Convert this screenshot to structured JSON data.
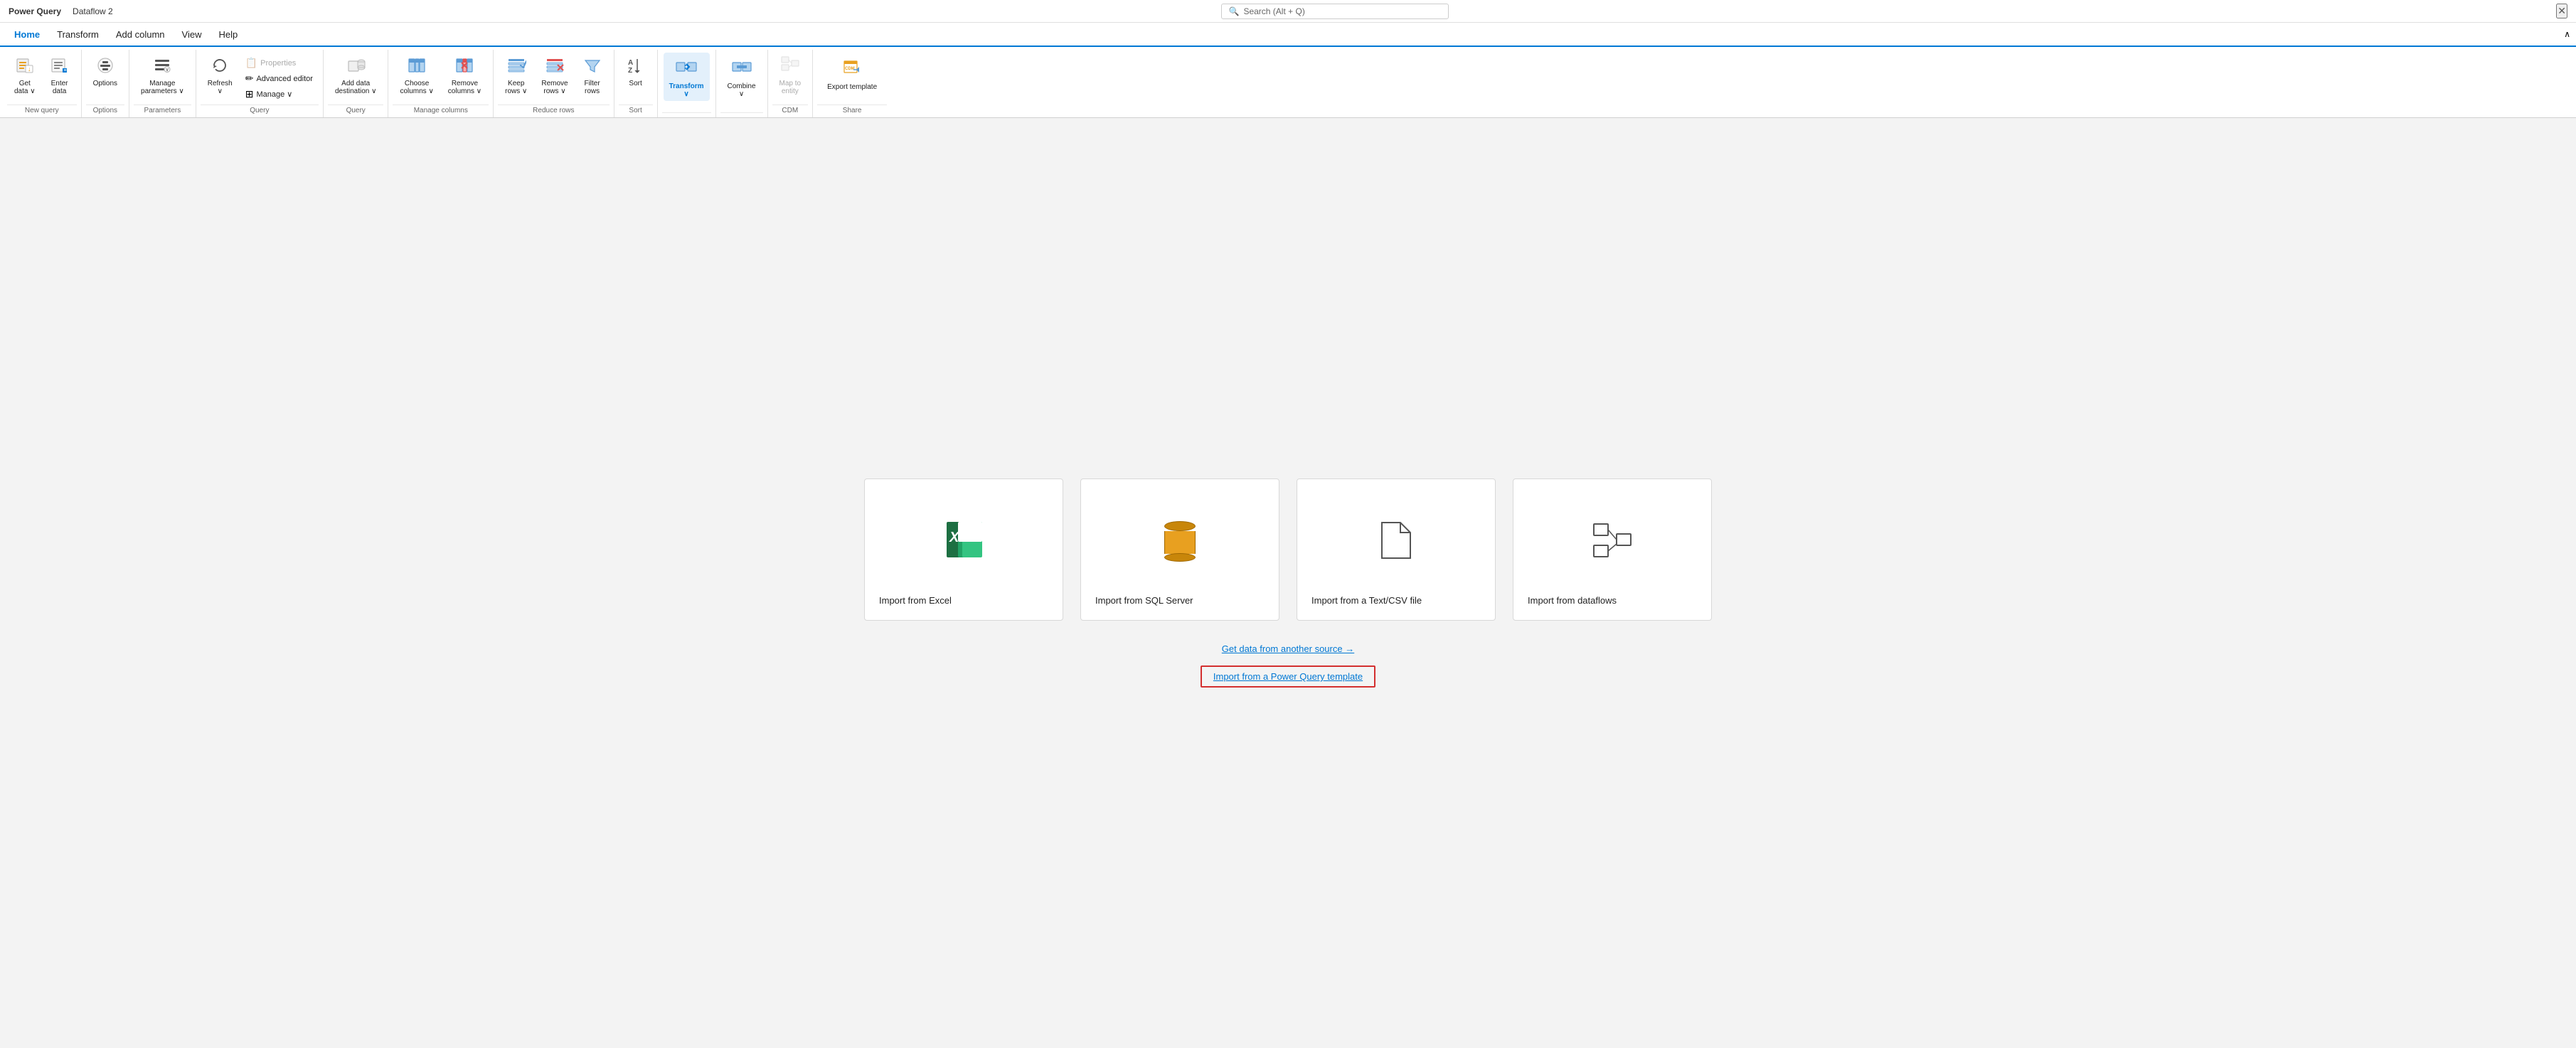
{
  "titleBar": {
    "appName": "Power Query",
    "docName": "Dataflow 2",
    "searchPlaceholder": "Search (Alt + Q)",
    "closeLabel": "✕"
  },
  "menuBar": {
    "items": [
      {
        "label": "Home",
        "active": true
      },
      {
        "label": "Transform",
        "active": false
      },
      {
        "label": "Add column",
        "active": false
      },
      {
        "label": "View",
        "active": false
      },
      {
        "label": "Help",
        "active": false
      }
    ]
  },
  "ribbon": {
    "groups": [
      {
        "label": "New query",
        "buttons": [
          {
            "id": "get-data",
            "label": "Get\ndata ∨",
            "icon": "📥",
            "type": "large"
          },
          {
            "id": "enter-data",
            "label": "Enter\ndata",
            "icon": "⌨",
            "type": "large"
          }
        ]
      },
      {
        "label": "Options",
        "buttons": [
          {
            "id": "options",
            "label": "Options",
            "icon": "⚙",
            "type": "large"
          }
        ]
      },
      {
        "label": "Parameters",
        "buttons": [
          {
            "id": "manage-parameters",
            "label": "Manage\nparameters ∨",
            "icon": "≡",
            "type": "large"
          }
        ]
      },
      {
        "label": "Query",
        "buttons": [
          {
            "id": "refresh",
            "label": "Refresh",
            "icon": "↻",
            "type": "large-sub"
          },
          {
            "id": "properties",
            "label": "Properties",
            "icon": "📋",
            "type": "small",
            "disabled": true
          },
          {
            "id": "advanced-editor",
            "label": "Advanced editor",
            "icon": "✏",
            "type": "small",
            "disabled": false
          },
          {
            "id": "manage",
            "label": "Manage ∨",
            "icon": "⊞",
            "type": "small"
          }
        ]
      },
      {
        "label": "Query",
        "buttons": [
          {
            "id": "add-data-destination",
            "label": "Add data\ndestination ∨",
            "icon": "🗄",
            "type": "large"
          }
        ]
      },
      {
        "label": "Manage columns",
        "buttons": [
          {
            "id": "choose-columns",
            "label": "Choose\ncolumns ∨",
            "icon": "⊞",
            "type": "large"
          },
          {
            "id": "remove-columns",
            "label": "Remove\ncolumns ∨",
            "icon": "⊟",
            "type": "large"
          }
        ]
      },
      {
        "label": "Reduce rows",
        "buttons": [
          {
            "id": "keep-rows",
            "label": "Keep\nrows ∨",
            "icon": "↑",
            "type": "large"
          },
          {
            "id": "remove-rows",
            "label": "Remove\nrows ∨",
            "icon": "✖",
            "type": "large"
          },
          {
            "id": "filter-rows",
            "label": "Filter\nrows",
            "icon": "▽",
            "type": "large"
          }
        ]
      },
      {
        "label": "Sort",
        "buttons": [
          {
            "id": "sort",
            "label": "AZ\nZA",
            "icon": "",
            "type": "sort"
          }
        ]
      },
      {
        "label": "",
        "buttons": [
          {
            "id": "transform",
            "label": "Transform\n∨",
            "icon": "⇄",
            "type": "large-highlight"
          }
        ]
      },
      {
        "label": "",
        "buttons": [
          {
            "id": "combine",
            "label": "Combine\n∨",
            "icon": "⬛",
            "type": "large"
          }
        ]
      },
      {
        "label": "CDM",
        "buttons": [
          {
            "id": "map-to-entity",
            "label": "Map to\nentity",
            "icon": "⊞",
            "type": "large",
            "disabled": true
          }
        ]
      },
      {
        "label": "Share",
        "buttons": [
          {
            "id": "export-template",
            "label": "Export template",
            "icon": "📤",
            "type": "large"
          }
        ]
      }
    ]
  },
  "mainContent": {
    "cards": [
      {
        "id": "excel",
        "label": "Import from Excel",
        "iconType": "excel"
      },
      {
        "id": "sql",
        "label": "Import from SQL Server",
        "iconType": "sql"
      },
      {
        "id": "textcsv",
        "label": "Import from a Text/CSV file",
        "iconType": "file"
      },
      {
        "id": "dataflows",
        "label": "Import from dataflows",
        "iconType": "dataflow"
      }
    ],
    "links": [
      {
        "id": "get-data-another",
        "label": "Get data from another source →",
        "highlighted": false
      },
      {
        "id": "import-template",
        "label": "Import from a Power Query template",
        "highlighted": true
      }
    ]
  },
  "collapseBtn": "∧"
}
